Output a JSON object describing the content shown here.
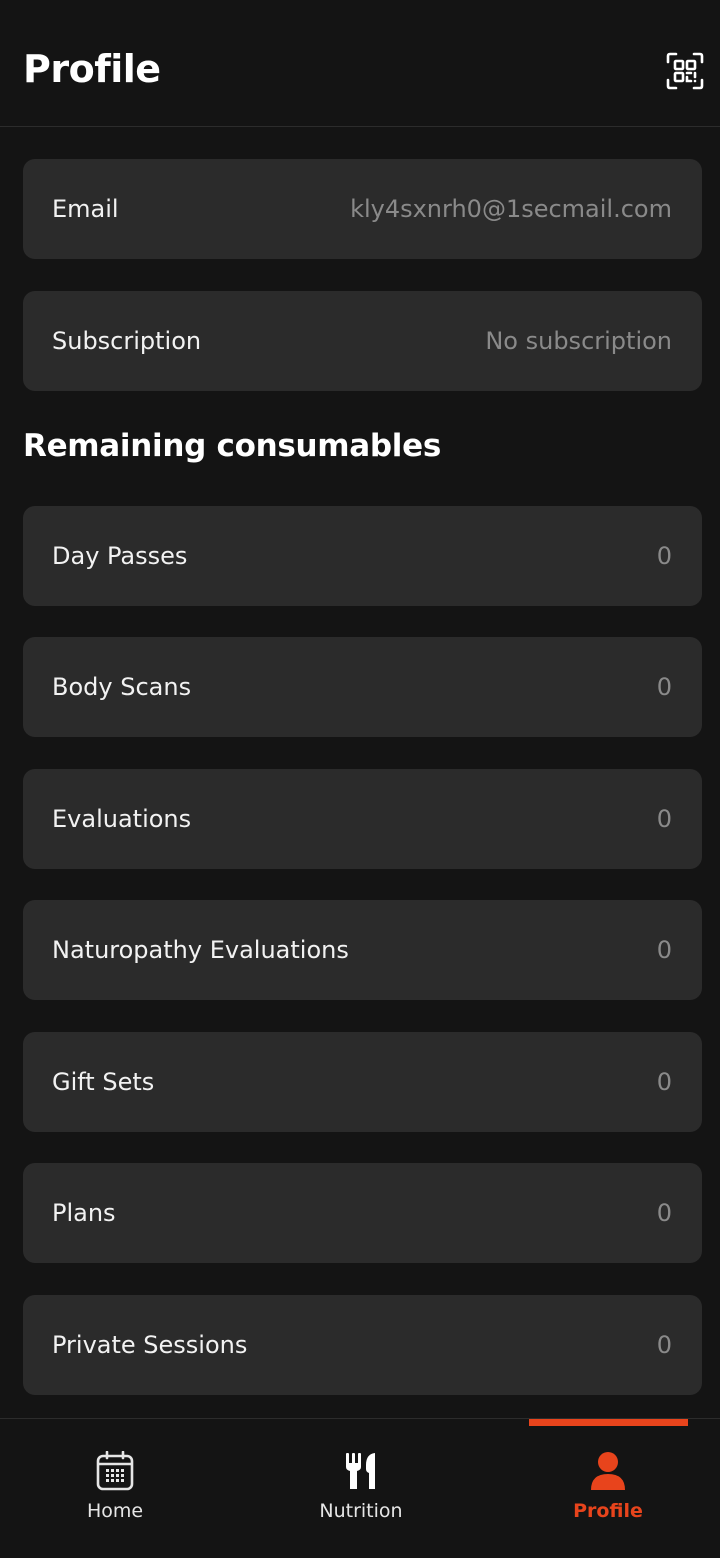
{
  "header": {
    "title": "Profile",
    "qr_icon": "qr-code-scan-icon"
  },
  "account": {
    "email_label": "Email",
    "email_value": "kly4sxnrh0@1secmail.com",
    "subscription_label": "Subscription",
    "subscription_value": "No subscription"
  },
  "consumables": {
    "heading": "Remaining consumables",
    "items": [
      {
        "label": "Day Passes",
        "value": "0"
      },
      {
        "label": "Body Scans",
        "value": "0"
      },
      {
        "label": "Evaluations",
        "value": "0"
      },
      {
        "label": "Naturopathy Evaluations",
        "value": "0"
      },
      {
        "label": "Gift Sets",
        "value": "0"
      },
      {
        "label": "Plans",
        "value": "0"
      },
      {
        "label": "Private Sessions",
        "value": "0"
      }
    ]
  },
  "nav": {
    "items": [
      {
        "label": "Home",
        "icon": "calendar-icon"
      },
      {
        "label": "Nutrition",
        "icon": "fork-knife-icon"
      },
      {
        "label": "Profile",
        "icon": "person-icon",
        "active": true
      }
    ]
  },
  "colors": {
    "background": "#141414",
    "card": "#2b2b2b",
    "accent": "#e8441c",
    "muted_text": "#8a8a8a"
  }
}
